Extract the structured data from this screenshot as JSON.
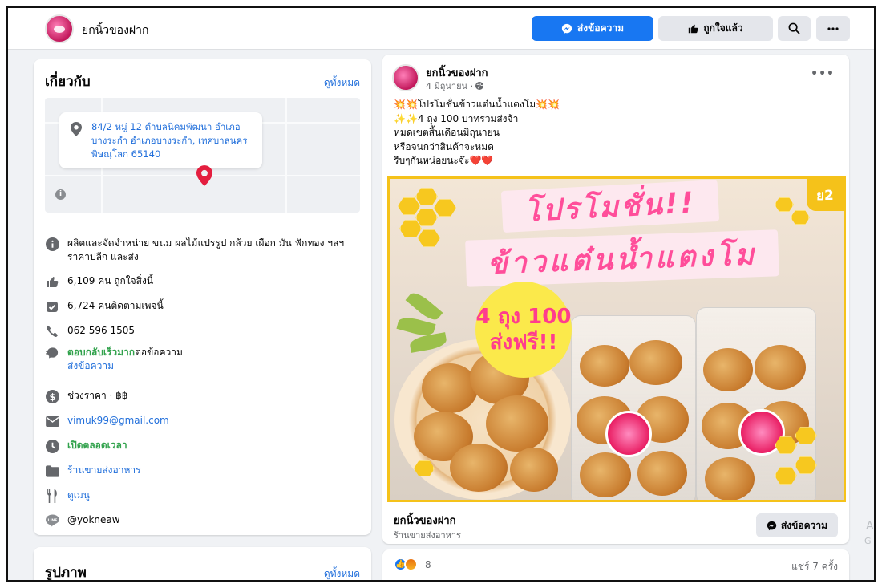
{
  "header": {
    "page_name": "ยกนิ้วของฝาก",
    "message_button": "ส่งข้อความ",
    "like_button": "ถูกใจแล้ว"
  },
  "about": {
    "title": "เกี่ยวกับ",
    "see_all": "ดูทั้งหมด",
    "address": "84/2 หมู่ 12 ตำบลนิคมพัฒนา อำเภอบางระกำ อำเภอบางระกำ, เทศบาลนครพิษณุโลก 65140",
    "description": "ผลิตและจัดจำหน่าย ขนม ผลไม้แปรรูป กล้วย เผือก มัน ฟักทอง ฯลฯ ราคาปลีก และส่ง",
    "likes": "6,109 คน ถูกใจสิ่งนี้",
    "followers": "6,724 คนติดตามเพจนี้",
    "phone": "062 596 1505",
    "response_fast": "ตอบกลับเร็วมาก",
    "response_rest": "ต่อข้อความ",
    "send_message": "ส่งข้อความ",
    "price_range": "ช่วงราคา · ฿฿",
    "email": "vimuk99@gmail.com",
    "hours": "เปิดตลอดเวลา",
    "category": "ร้านขายส่งอาหาร",
    "menu": "ดูเมนู",
    "line": "@yokneaw"
  },
  "photos": {
    "title": "รูปภาพ",
    "see_all": "ดูทั้งหมด"
  },
  "post": {
    "author": "ยกนิ้วของฝาก",
    "date": "4 มิถุนายน ·",
    "text": "💥💥โปรโมชั่นข้าวแต๋นน้ำแตงโม💥💥\n✨✨4 ถุง 100 บาทรวมส่งจ้า\nหมดเขตสิ้นเดือนมิถุนายน\nหรือจนกว่าสินค้าจะหมด\nรีบๆกันหน่อยนะจ๊ะ❤️❤️",
    "image": {
      "banner_top": "โปรโมชั่น!!",
      "banner_bottom": "ข้าวแต๋นน้ำแตงโม",
      "badge_line1": "4 ถุง 100",
      "badge_line2": "ส่งฟรี!!",
      "corner_tag": "ย2"
    },
    "footer_name": "ยกนิ้วของฝาก",
    "footer_category": "ร้านขายส่งอาหาร",
    "footer_button": "ส่งข้อความ",
    "reaction_count": "8",
    "shares": "แชร์ 7 ครั้ง"
  },
  "colors": {
    "accent": "#1877f2",
    "link": "#216fdb",
    "open_green": "#31a24c",
    "promo_pink": "#ff4e9a",
    "honey_yellow": "#f5c21a"
  }
}
